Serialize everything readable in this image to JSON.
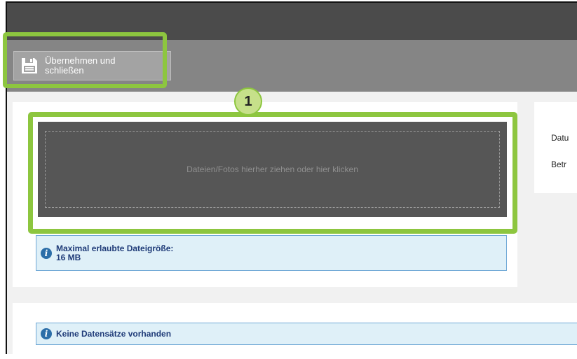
{
  "toolbar": {
    "save_close_label": "Übernehmen und schließen"
  },
  "annotation": {
    "step_number": "1"
  },
  "upload": {
    "dropzone_text": "Dateien/Fotos hierher ziehen oder hier klicken"
  },
  "info": {
    "max_size_label": "Maximal erlaubte Dateigröße:",
    "max_size_value": "16 MB",
    "no_records": "Keine Datensätze vorhanden"
  },
  "side_panel": {
    "field1_label": "Datu",
    "field2_label": "Betr"
  },
  "colors": {
    "highlight": "#8dc63f",
    "info_text": "#1f3b78",
    "info_bg": "#dff0f8"
  },
  "icons": {
    "save": "floppy-disk-icon",
    "info": "info-icon"
  }
}
